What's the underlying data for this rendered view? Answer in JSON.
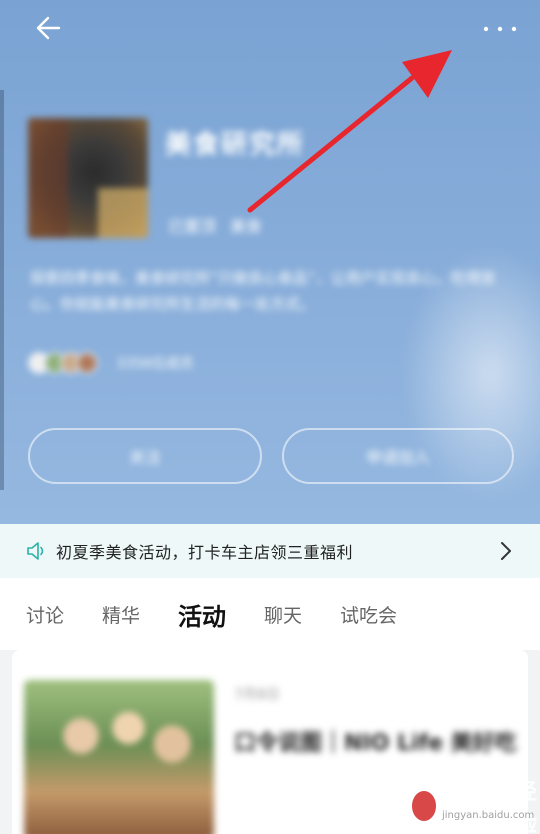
{
  "header": {
    "back_icon": "arrow-left-icon",
    "more_icon": "more-horizontal-icon",
    "group_name": "美食研究所",
    "group_meta": [
      "已置顶",
      "美食"
    ],
    "group_desc": "探索四季食味，美食研究所“只做良心食品”，让用户实现良心，吃得放心。你就能美食研究所生活的每一处方式。",
    "member_count": "3356位成员",
    "join_left_label": "关注",
    "join_right_label": "申请加入"
  },
  "notice": {
    "speaker_icon": "speaker-icon",
    "text": "初夏季美食活动，打卡车主店领三重福利",
    "chevron_icon": "chevron-right-icon"
  },
  "tabs": [
    {
      "label": "讨论",
      "active": false
    },
    {
      "label": "精华",
      "active": false
    },
    {
      "label": "活动",
      "active": true
    },
    {
      "label": "聊天",
      "active": false
    },
    {
      "label": "试吃会",
      "active": false
    }
  ],
  "activity_card": {
    "date": "7月8日",
    "title": "口令说图｜NIO Life 美好吃",
    "extra": ""
  },
  "annotation": {
    "color": "#e8262d"
  },
  "watermark": {
    "brand": "Baidu",
    "suffix": "经验",
    "sub": "jingyan.baidu.com"
  },
  "colors": {
    "header_bg": "#86acd9",
    "notice_bg": "#eef8f8",
    "speaker": "#2bb3a5",
    "annotation_arrow": "#e8262d"
  }
}
